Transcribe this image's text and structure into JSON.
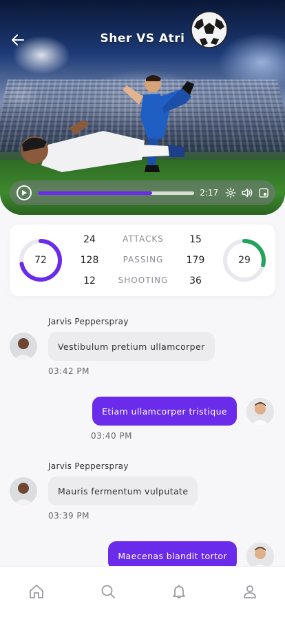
{
  "header": {
    "title": "Sher VS Atri"
  },
  "video": {
    "time": "2:17",
    "progress": 0.73
  },
  "stats": {
    "home_score": "72",
    "away_score": "29",
    "home_ring": 0.72,
    "away_ring": 0.29,
    "rows": [
      {
        "home": "24",
        "label": "ATTACKS",
        "away": "15"
      },
      {
        "home": "128",
        "label": "PASSING",
        "away": "179"
      },
      {
        "home": "12",
        "label": "SHOOTING",
        "away": "36"
      }
    ]
  },
  "chat": {
    "messages": [
      {
        "direction": "in",
        "sender": "Jarvis Pepperspray",
        "text": "Vestibulum pretium ullamcorper",
        "time": "03:42 PM"
      },
      {
        "direction": "out",
        "sender": "",
        "text": "Etiam ullamcorper tristique",
        "time": "03:40 PM"
      },
      {
        "direction": "in",
        "sender": "Jarvis Pepperspray",
        "text": "Mauris fermentum vulputate",
        "time": "03:39 PM"
      },
      {
        "direction": "out",
        "sender": "",
        "text": "Maecenas blandit tortor",
        "time": ""
      }
    ]
  },
  "colors": {
    "accent": "#6B2BEA",
    "away_accent": "#22A45D",
    "ring_track": "#E8E8EE"
  },
  "icons": {
    "back": "arrow-left-icon",
    "play": "play-icon",
    "settings": "gear-icon",
    "volume": "volume-icon",
    "pip": "picture-in-picture-icon",
    "nav": [
      "home-icon",
      "search-icon",
      "bell-icon",
      "user-icon"
    ]
  }
}
